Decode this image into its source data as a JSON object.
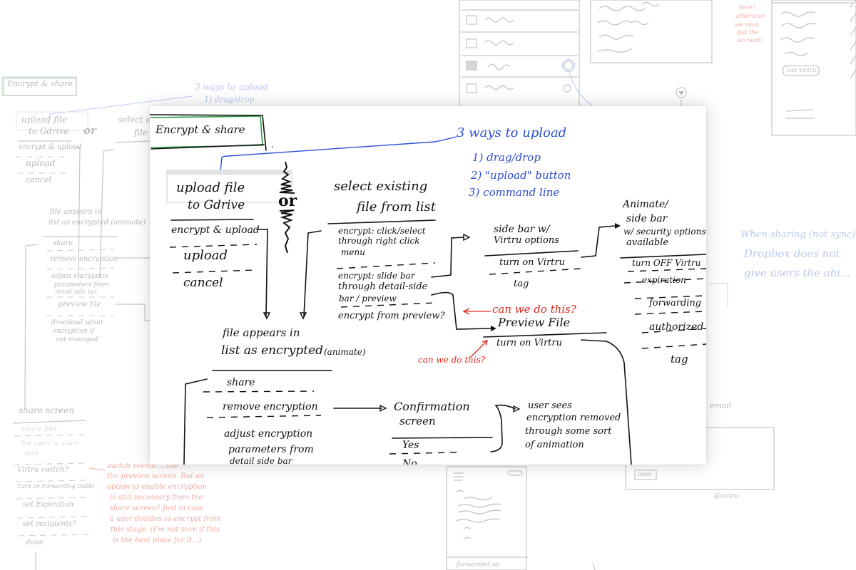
{
  "colors": {
    "ink": "#111111",
    "blue_note": "#2b4fd6",
    "red_note": "#e0261b",
    "title_box": "#2e9a48",
    "faint_ink": "#b8b8b8",
    "faint_blue": "#b9c8ee",
    "faint_red": "#f2a99d"
  },
  "main_sketch": {
    "title": "Encrypt & share",
    "upload_note": {
      "heading": "3 ways to upload",
      "items": [
        "1) drag/drop",
        "2) \"upload\" button",
        "3) command line"
      ]
    },
    "upload_box": {
      "title_line1": "upload file",
      "title_line2": "to Gdrive",
      "options": [
        "encrypt & upload",
        "upload",
        "cancel"
      ]
    },
    "or_label": "or",
    "select_box": {
      "title_line1": "select existing",
      "title_line2": "file from list",
      "options": [
        [
          "encrypt: click/select",
          "through right click",
          "menu"
        ],
        [
          "encrypt: slide bar",
          "through detail-side",
          "bar / preview"
        ],
        [
          "encrypt from preview?"
        ]
      ]
    },
    "side_bar_box": {
      "title_line1": "side bar w/",
      "title_line2": "Virtru options",
      "options": [
        "turn on Virtru",
        "tag"
      ]
    },
    "security_box": {
      "title_lines": [
        "Animate/",
        "side bar",
        "w/ security options",
        "available"
      ],
      "options": [
        "turn OFF Virtru",
        "expiration",
        "forwarding",
        "authorized",
        "tag"
      ]
    },
    "preview_box": {
      "title": "Preview File",
      "options": [
        "turn on Virtru"
      ]
    },
    "red_notes": [
      "can we do this?",
      "can we do this?"
    ],
    "encrypted_box": {
      "title_line1": "file appears in",
      "title_line2": "list as encrypted",
      "title_suffix": "(animate)",
      "options": [
        "share",
        "remove encryption",
        "adjust encryption",
        "parameters from",
        "detail side bar"
      ]
    },
    "confirmation_box": {
      "title_line1": "Confirmation",
      "title_line2": "screen",
      "options": [
        "Yes",
        "No"
      ]
    },
    "result_note": [
      "user sees",
      "encryption removed",
      "through some sort",
      "of animation"
    ]
  },
  "background_sketch": {
    "title": "Encrypt & share",
    "upload_note": [
      "3 ways to upload",
      "1) drag/drop"
    ],
    "upload_box": [
      "upload file",
      "to Gdrive",
      "encrypt & upload",
      "upload",
      "cancel"
    ],
    "or_label": "or",
    "select_box": [
      "select existing",
      "file"
    ],
    "encrypted_box": [
      "file appears in",
      "list as encrypted (animate)",
      "share",
      "remove encryption",
      "adjust encryption",
      "parameters from",
      "detail side bar",
      "preview file",
      "download w/out",
      "encryption if",
      "not managed"
    ],
    "share_screen": {
      "title": "share screen",
      "options": [
        "share link",
        "list users to share",
        "with",
        "Virtru switch?",
        "Turn on Forwarding Dabbl",
        "set Expiration",
        "set recipients?",
        "done"
      ]
    },
    "red_note": [
      "switch seems ... the",
      "the preview screen. But an",
      "option to enable encryption",
      "is still necessary from the",
      "share screen? Just in case",
      "a user decides to encrypt from",
      "this stage. (I'm not sure if this",
      "is the best place for it...)"
    ],
    "top_red_note": [
      "here?",
      "otherwise",
      "we must",
      "put the",
      "account!"
    ],
    "get_virtru_button": "Get Virtru",
    "blue_note_right": [
      "When sharing (not sync)",
      "Dropbox does not",
      "give users the abi..."
    ],
    "email_label": "email",
    "open_button": "open",
    "virtru_label": "@virtru",
    "forwarded_label": "forwarded to"
  }
}
